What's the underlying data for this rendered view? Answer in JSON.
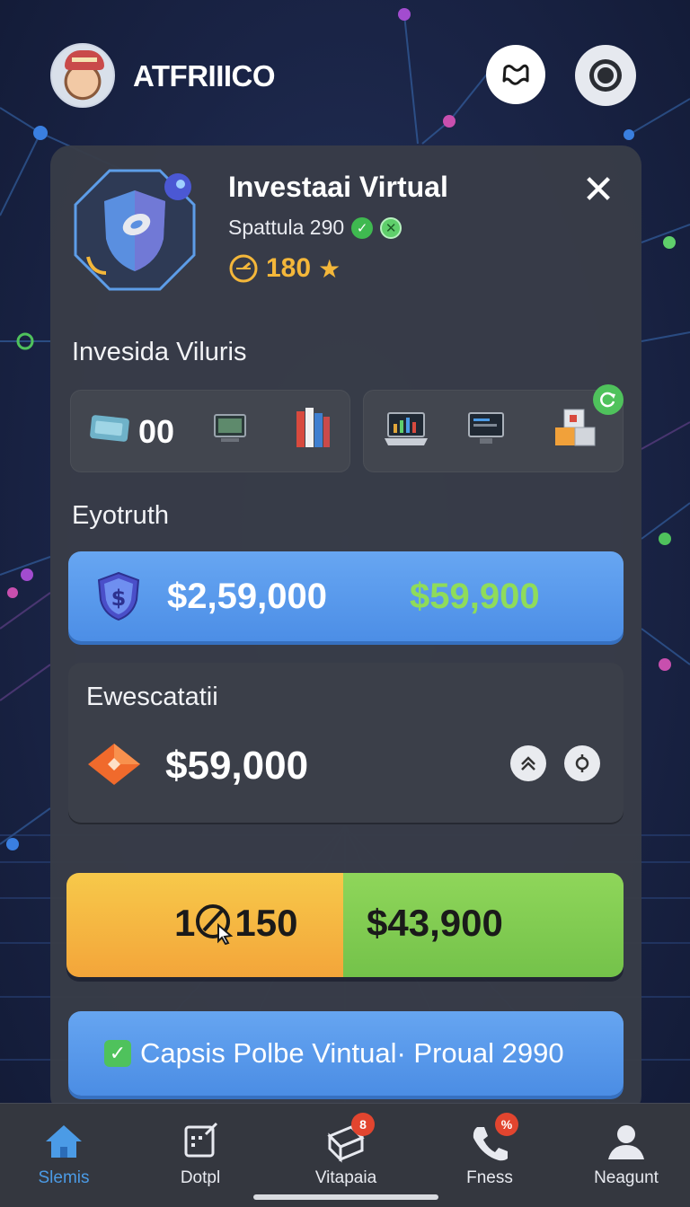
{
  "header": {
    "app_title": "ATFRIIICO",
    "avatar_icon": "user-avatar",
    "map_button_icon": "map-icon",
    "settings_button_icon": "settings-ring-icon"
  },
  "item": {
    "name": "Investaai Virtual",
    "subtitle": "Spattula 290",
    "rating": "180",
    "badge_icon": "shield-icon",
    "close_label": "✕"
  },
  "section_slots": {
    "title": "Invesida Viluris",
    "slot_count": "00",
    "left_icons": [
      "ticket-icon",
      "monitor-icon",
      "books-icon"
    ],
    "right_icons": [
      "laptop-chart-icon",
      "desktop-icon",
      "boxes-icon"
    ]
  },
  "section_value": {
    "title": "Eyotruth",
    "primary_value": "$2,59,000",
    "secondary_value": "$59,900",
    "icon": "dollar-shield-icon"
  },
  "exchange": {
    "title": "Ewescatatii",
    "value": "$59,000",
    "icon": "gem-icon",
    "buttons": [
      "double-chevron-up-icon",
      "target-icon"
    ]
  },
  "split_bar": {
    "left_prefix": "1",
    "left_value": "150",
    "right_value": "$43,900",
    "icon": "cursor-dial-icon"
  },
  "cta": {
    "label": "Capsis Polbe Vintual· Proual 2990"
  },
  "nav": {
    "items": [
      {
        "label": "Slemis",
        "icon": "home-icon",
        "badge": ""
      },
      {
        "label": "Dotpl",
        "icon": "calendar-edit-icon",
        "badge": ""
      },
      {
        "label": "Vitapaia",
        "icon": "package-icon",
        "badge": "8"
      },
      {
        "label": "Fness",
        "icon": "phone-icon",
        "badge": "%"
      },
      {
        "label": "Neagunt",
        "icon": "profile-icon",
        "badge": ""
      }
    ]
  },
  "colors": {
    "accent_blue": "#4c8ee6",
    "accent_green": "#8fdc5a",
    "accent_orange": "#f3a53a",
    "gold": "#f4b73a",
    "panel": "#383c48"
  }
}
